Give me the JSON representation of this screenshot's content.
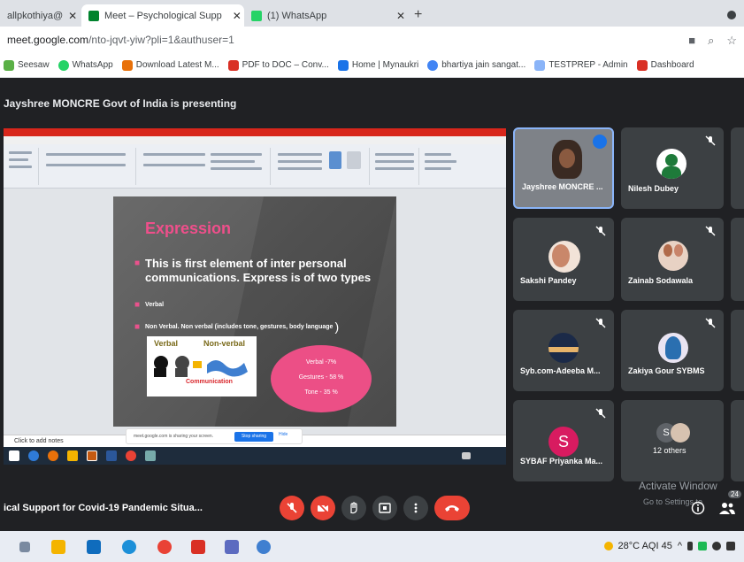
{
  "browser": {
    "tabs": [
      {
        "label": "allpkothiya@",
        "active": false
      },
      {
        "label": "Meet – Psychological Supp",
        "active": true,
        "recording": true
      },
      {
        "label": "(1) WhatsApp",
        "active": false
      }
    ],
    "url_host": "meet.google.com",
    "url_path": "/nto-jqvt-yiw?pli=1&authuser=1",
    "bookmarks": [
      {
        "label": "Seesaw",
        "color": "#5ab046"
      },
      {
        "label": "WhatsApp",
        "color": "#25d366"
      },
      {
        "label": "Download Latest M...",
        "color": "#e8710a"
      },
      {
        "label": "PDF to DOC – Conv...",
        "color": "#d93025"
      },
      {
        "label": "Home | Mynaukri",
        "color": "#1a73e8"
      },
      {
        "label": "bhartiya jain sangat...",
        "color": "#4285f4"
      },
      {
        "label": "TESTPREP - Admin",
        "color": "#8ab4f8"
      },
      {
        "label": "Dashboard",
        "color": "#d93025"
      }
    ]
  },
  "meet": {
    "presenting_label": "Jayshree MONCRE Govt of India is presenting",
    "meeting_title": "ical Support for Covid-19 Pandemic Situa...",
    "participants": [
      {
        "name": "Jayshree MONCRE ...",
        "speaking": true
      },
      {
        "name": "Nilesh Dubey",
        "speaking": false
      },
      {
        "name": "Sakshi Pandey",
        "speaking": false
      },
      {
        "name": "Zainab Sodawala",
        "speaking": false
      },
      {
        "name": "Syb.com-Adeeba M...",
        "speaking": false
      },
      {
        "name": "Zakiya Gour SYBMS",
        "speaking": false
      },
      {
        "name": "SYBAF Priyanka Ma...",
        "initial": "S",
        "speaking": false
      },
      {
        "name": "12 others",
        "initial": "S",
        "speaking": false
      }
    ],
    "people_count": "24",
    "activate_line1": "Activate Window",
    "activate_line2": "Go to Settings to"
  },
  "shared_screen": {
    "notes_placeholder": "Click to add notes",
    "share_text": "meet.google.com is sharing your screen.",
    "stop_sharing_label": "Stop sharing",
    "hide_label": "Hide",
    "slide": {
      "title": "Expression",
      "bullet1": "This is first element of inter personal communications. Express is of two types",
      "bullet2": "Verbal",
      "bullet3": "Non Verbal. Non verbal (includes tone, gestures, body language",
      "bullet3_paren": ")",
      "image_verbal": "Verbal",
      "image_nonverbal": "Non-verbal",
      "image_comm": "Communication",
      "ellipse_lines": [
        "Verbal -7%",
        "Gestures - 58 %",
        "Tone - 35 %"
      ]
    }
  },
  "taskbar": {
    "weather": "28°C  AQI 45"
  }
}
